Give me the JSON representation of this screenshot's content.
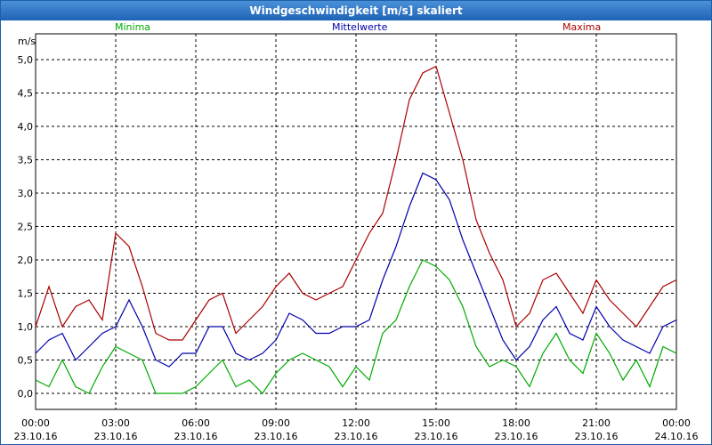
{
  "window": {
    "title": "Windgeschwindigkeit [m/s] skaliert"
  },
  "legend": {
    "minima": "Minima",
    "mittelwerte": "Mittelwerte",
    "maxima": "Maxima"
  },
  "colors": {
    "minima": "#00aa00",
    "mittelwerte": "#0000aa",
    "maxima": "#aa0000"
  },
  "chart_data": {
    "type": "line",
    "ylabel": "m/s",
    "ylim": [
      0,
      5.2
    ],
    "yticks": [
      "0,0",
      "0,5",
      "1,0",
      "1,5",
      "2,0",
      "2,5",
      "3,0",
      "3,5",
      "4,0",
      "4,5",
      "5,0"
    ],
    "xticks": [
      {
        "time": "00:00",
        "date": "23.10.16"
      },
      {
        "time": "03:00",
        "date": "23.10.16"
      },
      {
        "time": "06:00",
        "date": "23.10.16"
      },
      {
        "time": "09:00",
        "date": "23.10.16"
      },
      {
        "time": "12:00",
        "date": "23.10.16"
      },
      {
        "time": "15:00",
        "date": "23.10.16"
      },
      {
        "time": "18:00",
        "date": "23.10.16"
      },
      {
        "time": "21:00",
        "date": "23.10.16"
      },
      {
        "time": "00:00",
        "date": "24.10.16"
      }
    ],
    "x": [
      "00:00",
      "00:30",
      "01:00",
      "01:30",
      "02:00",
      "02:30",
      "03:00",
      "03:30",
      "04:00",
      "04:30",
      "05:00",
      "05:30",
      "06:00",
      "06:30",
      "07:00",
      "07:30",
      "08:00",
      "08:30",
      "09:00",
      "09:30",
      "10:00",
      "10:30",
      "11:00",
      "11:30",
      "12:00",
      "12:30",
      "13:00",
      "13:30",
      "14:00",
      "14:30",
      "15:00",
      "15:30",
      "16:00",
      "16:30",
      "17:00",
      "17:30",
      "18:00",
      "18:30",
      "19:00",
      "19:30",
      "20:00",
      "20:30",
      "21:00",
      "21:30",
      "22:00",
      "22:30",
      "23:00",
      "23:30",
      "00:00"
    ],
    "series": [
      {
        "name": "Minima",
        "color": "#00aa00",
        "values": [
          0.2,
          0.1,
          0.5,
          0.1,
          0.0,
          0.4,
          0.7,
          0.6,
          0.5,
          0.0,
          0.0,
          0.0,
          0.1,
          0.3,
          0.5,
          0.1,
          0.2,
          0.0,
          0.3,
          0.5,
          0.6,
          0.5,
          0.4,
          0.1,
          0.4,
          0.2,
          0.9,
          1.1,
          1.6,
          2.0,
          1.9,
          1.7,
          1.3,
          0.7,
          0.4,
          0.5,
          0.4,
          0.1,
          0.6,
          0.9,
          0.5,
          0.3,
          0.9,
          0.6,
          0.2,
          0.5,
          0.1,
          0.7,
          0.6
        ]
      },
      {
        "name": "Mittelwerte",
        "color": "#0000aa",
        "values": [
          0.6,
          0.8,
          0.9,
          0.5,
          0.7,
          0.9,
          1.0,
          1.4,
          1.0,
          0.5,
          0.4,
          0.6,
          0.6,
          1.0,
          1.0,
          0.6,
          0.5,
          0.6,
          0.8,
          1.2,
          1.1,
          0.9,
          0.9,
          1.0,
          1.0,
          1.1,
          1.7,
          2.2,
          2.8,
          3.3,
          3.2,
          2.9,
          2.3,
          1.8,
          1.3,
          0.8,
          0.5,
          0.7,
          1.1,
          1.3,
          0.9,
          0.8,
          1.3,
          1.0,
          0.8,
          0.7,
          0.6,
          1.0,
          1.1
        ]
      },
      {
        "name": "Maxima",
        "color": "#aa0000",
        "values": [
          1.0,
          1.6,
          1.0,
          1.3,
          1.4,
          1.1,
          2.4,
          2.2,
          1.6,
          0.9,
          0.8,
          0.8,
          1.1,
          1.4,
          1.5,
          0.9,
          1.1,
          1.3,
          1.6,
          1.8,
          1.5,
          1.4,
          1.5,
          1.6,
          2.0,
          2.4,
          2.7,
          3.5,
          4.4,
          4.8,
          4.9,
          4.2,
          3.5,
          2.6,
          2.1,
          1.7,
          1.0,
          1.2,
          1.7,
          1.8,
          1.5,
          1.2,
          1.7,
          1.4,
          1.2,
          1.0,
          1.3,
          1.6,
          1.7
        ]
      }
    ],
    "grid": true
  }
}
